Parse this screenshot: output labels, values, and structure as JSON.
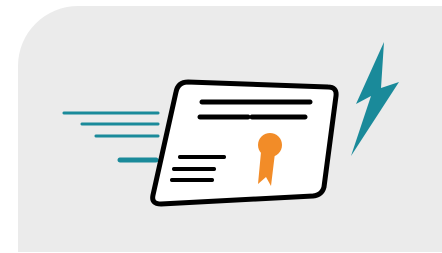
{
  "illustration": {
    "icon": "fast-certificate-icon",
    "colors": {
      "panel": "#ebebeb",
      "certificate_fill": "#ffffff",
      "outline": "#000000",
      "speed_lines": "#1a8a9a",
      "bolt": "#1a8a9a",
      "badge": "#f28c28"
    }
  }
}
